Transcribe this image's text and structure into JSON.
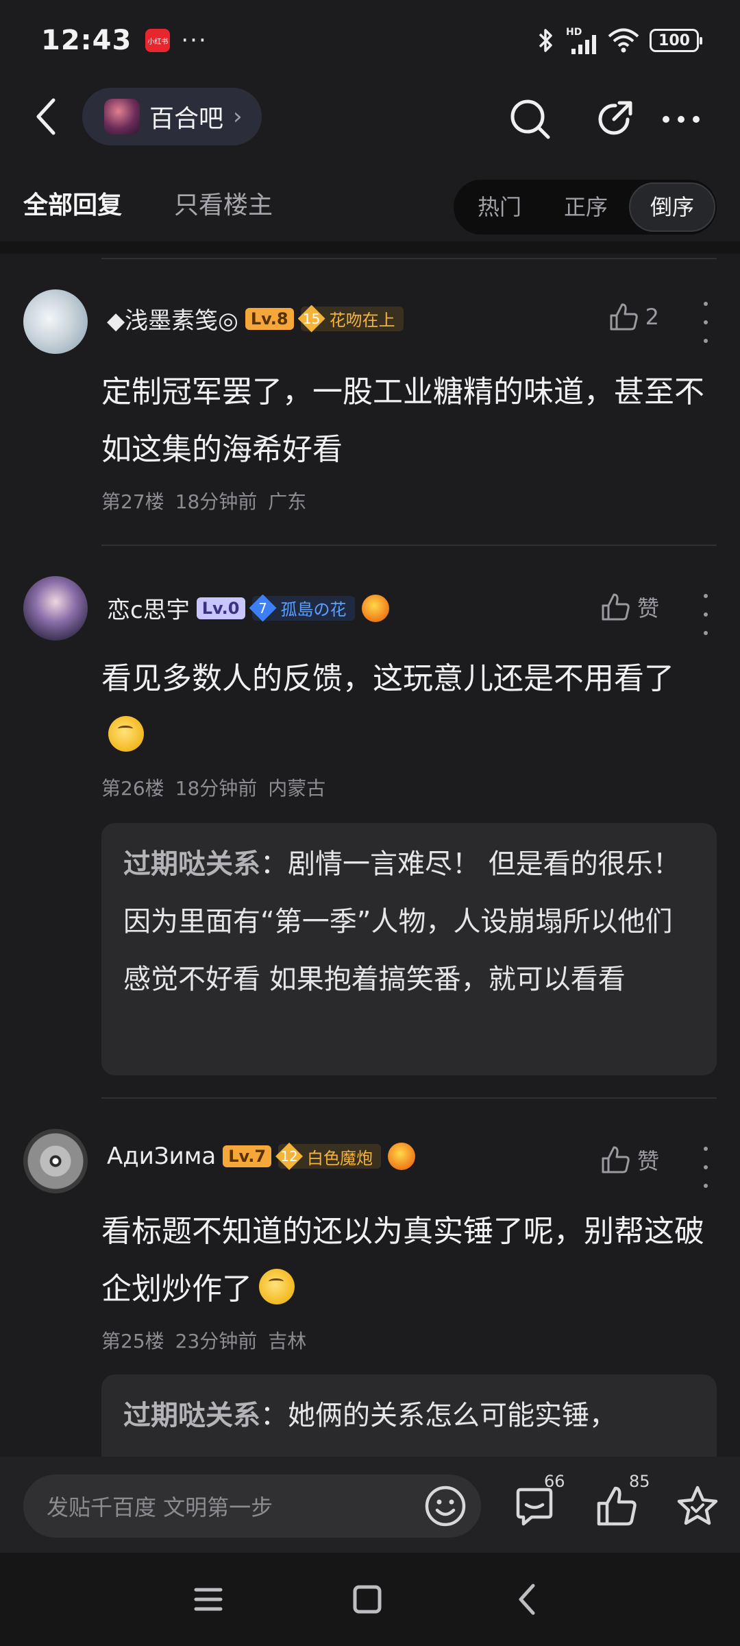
{
  "status_bar": {
    "time": "12:43",
    "app_badge": "小红书",
    "dots": "···",
    "network": "HD",
    "battery": "100"
  },
  "nav": {
    "forum_name": "百合吧",
    "chevron": "›"
  },
  "filters": {
    "tab_all": "全部回复",
    "tab_op": "只看楼主",
    "sort": [
      "热门",
      "正序",
      "倒序"
    ],
    "sort_active": "倒序"
  },
  "posts": [
    {
      "username": "◆浅墨素笺◎",
      "level": "Lv.8",
      "badge_num": "15",
      "badge_text": "花吻在上",
      "likes": "2",
      "content": "定制冠军罢了，一股工业糖精的味道，甚至不如这集的海希好看",
      "floor": "第27楼",
      "time": "18分钟前",
      "location": "广东"
    },
    {
      "username": "恋c思宇",
      "level": "Lv.0",
      "badge_num": "7",
      "badge_text": "孤島の花",
      "likes": "赞",
      "content": "看见多数人的反馈，这玩意儿还是不用看了",
      "floor": "第26楼",
      "time": "18分钟前",
      "location": "内蒙古",
      "reply": {
        "name": "过期哒关系",
        "text": "：剧情一言难尽！ 但是看的很乐！ 因为里面有“第一季”人物，人设崩塌所以他们感觉不好看 如果抱着搞笑番，就可以看看"
      }
    },
    {
      "username": "АдиЗима",
      "level": "Lv.7",
      "badge_num": "12",
      "badge_text": "白色魔炮",
      "likes": "赞",
      "content": "看标题不知道的还以为真实锤了呢，别帮这破企划炒作了",
      "floor": "第25楼",
      "time": "23分钟前",
      "location": "吉林",
      "reply": {
        "name": "过期哒关系",
        "text": "：她俩的关系怎么可能实锤，"
      }
    }
  ],
  "input_bar": {
    "placeholder": "发贴千百度 文明第一步",
    "comment_count": "66",
    "like_count": "85"
  },
  "colors": {
    "background": "#1c1c1e",
    "level_orange": "#f5a73a",
    "level_purple": "#c9c6ff",
    "badge_gold": "#f4b43a",
    "badge_blue": "#3d7ff5"
  }
}
